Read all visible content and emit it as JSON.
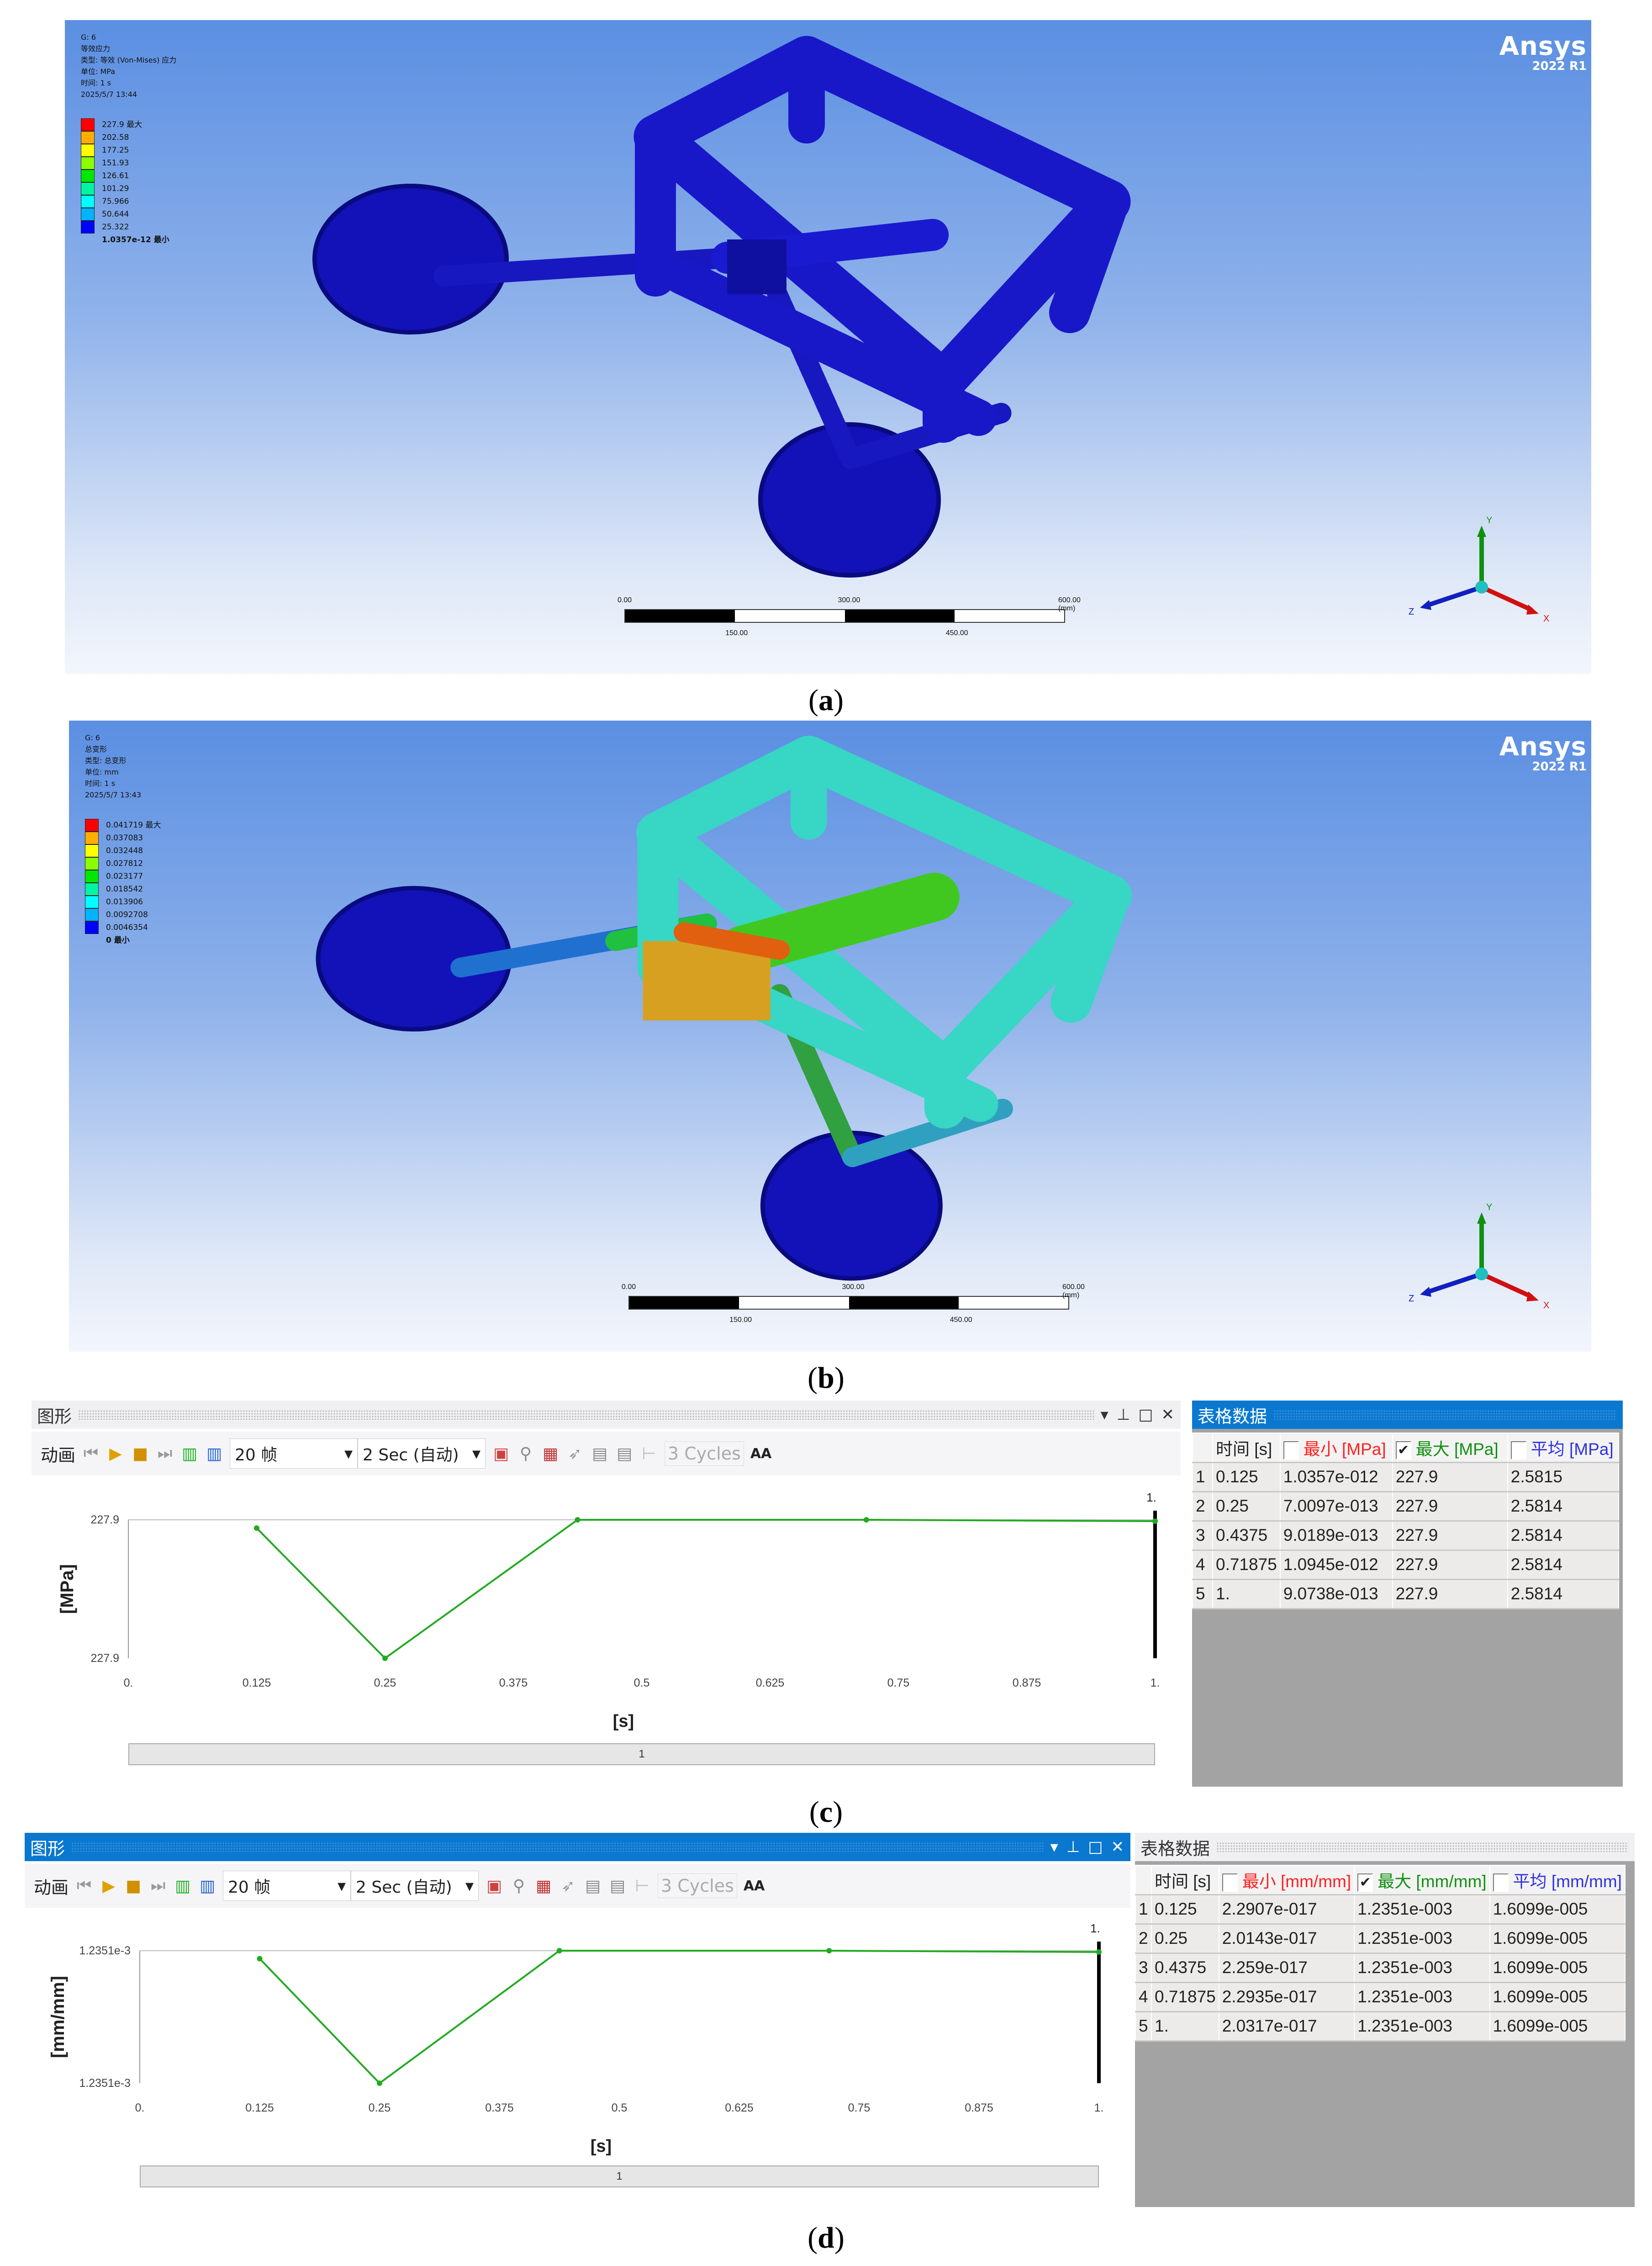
{
  "panel_a": {
    "caption": "a",
    "legend_header": [
      "G: 6",
      "等效应力",
      "类型: 等效 (Von-Mises) 应力",
      "单位: MPa",
      "时间: 1 s",
      "2025/5/7 13:44"
    ],
    "legend_values": [
      "227.9 最大",
      "202.58",
      "177.25",
      "151.93",
      "126.61",
      "101.29",
      "75.966",
      "50.644",
      "25.322",
      "1.0357e-12 最小"
    ],
    "logo": "Ansys",
    "version": "2022 R1",
    "scale_top": [
      "0.00",
      "300.00",
      "600.00 (mm)"
    ],
    "scale_bottom": [
      "150.00",
      "450.00"
    ],
    "axes": [
      "Y",
      "Z",
      "X"
    ]
  },
  "panel_b": {
    "caption": "b",
    "legend_header": [
      "G: 6",
      "总变形",
      "类型: 总变形",
      "单位: mm",
      "时间: 1 s",
      "2025/5/7 13:43"
    ],
    "legend_values": [
      "0.041719 最大",
      "0.037083",
      "0.032448",
      "0.027812",
      "0.023177",
      "0.018542",
      "0.013906",
      "0.0092708",
      "0.0046354",
      "0 最小"
    ],
    "logo": "Ansys",
    "version": "2022 R1",
    "scale_top": [
      "0.00",
      "300.00",
      "600.00 (mm)"
    ],
    "scale_bottom": [
      "150.00",
      "450.00"
    ],
    "axes": [
      "Y",
      "Z",
      "X"
    ]
  },
  "legend_colors": [
    "#ff0000",
    "#ffad00",
    "#ffff00",
    "#8cff00",
    "#00e800",
    "#00f5a0",
    "#00ffff",
    "#00b4ff",
    "#0000ff"
  ],
  "toolbar": {
    "animation": "动画",
    "frames": "20 帧",
    "duration": "2 Sec (自动)",
    "cycles": "3 Cycles",
    "aa": "AA"
  },
  "panel_c": {
    "caption": "c",
    "graph_title": "图形",
    "table_title": "表格数据",
    "table_headers": [
      "时间 [s]",
      "最小 [MPa]",
      "最大 [MPa]",
      "平均 [MPa]"
    ],
    "header_checked": [
      false,
      true,
      false
    ],
    "rows": [
      [
        "1",
        "0.125",
        "1.0357e-012",
        "227.9",
        "2.5815"
      ],
      [
        "2",
        "0.25",
        "7.0097e-013",
        "227.9",
        "2.5814"
      ],
      [
        "3",
        "0.4375",
        "9.0189e-013",
        "227.9",
        "2.5814"
      ],
      [
        "4",
        "0.71875",
        "1.0945e-012",
        "227.9",
        "2.5814"
      ],
      [
        "5",
        "1.",
        "9.0738e-013",
        "227.9",
        "2.5814"
      ]
    ],
    "scroll_label": "1"
  },
  "panel_d": {
    "caption": "d",
    "graph_title": "图形",
    "table_title": "表格数据",
    "table_headers": [
      "时间 [s]",
      "最小 [mm/mm]",
      "最大 [mm/mm]",
      "平均 [mm/mm]"
    ],
    "header_checked": [
      false,
      true,
      false
    ],
    "rows": [
      [
        "1",
        "0.125",
        "2.2907e-017",
        "1.2351e-003",
        "1.6099e-005"
      ],
      [
        "2",
        "0.25",
        "2.0143e-017",
        "1.2351e-003",
        "1.6099e-005"
      ],
      [
        "3",
        "0.4375",
        "2.259e-017",
        "1.2351e-003",
        "1.6099e-005"
      ],
      [
        "4",
        "0.71875",
        "2.2935e-017",
        "1.2351e-003",
        "1.6099e-005"
      ],
      [
        "5",
        "1.",
        "2.0317e-017",
        "1.2351e-003",
        "1.6099e-005"
      ]
    ],
    "scroll_label": "1"
  },
  "header_colors": [
    "#222222",
    "#ff2020",
    "#109010",
    "#3030e0"
  ],
  "chart_data": [
    {
      "type": "line",
      "ylabel": "[MPa]",
      "xlabel": "[s]",
      "x_ticks": [
        "0.",
        "0.125",
        "0.25",
        "0.375",
        "0.5",
        "0.625",
        "0.75",
        "0.875",
        "1."
      ],
      "xlim": [
        0,
        1
      ],
      "y_tick_labels": [
        "227.9",
        "227.9"
      ],
      "cursor_label": "1.",
      "series": [
        {
          "name": "最大 [MPa]",
          "color": "#22aa22",
          "x": [
            0.125,
            0.25,
            0.4375,
            0.71875,
            1.0
          ],
          "relative_y": [
            0.94,
            0.0,
            1.0,
            1.0,
            0.99
          ]
        }
      ]
    },
    {
      "type": "line",
      "ylabel": "[mm/mm]",
      "xlabel": "[s]",
      "x_ticks": [
        "0.",
        "0.125",
        "0.25",
        "0.375",
        "0.5",
        "0.625",
        "0.75",
        "0.875",
        "1."
      ],
      "xlim": [
        0,
        1
      ],
      "y_tick_labels": [
        "1.2351e-3",
        "1.2351e-3"
      ],
      "cursor_label": "1.",
      "series": [
        {
          "name": "最大 [mm/mm]",
          "color": "#22aa22",
          "x": [
            0.125,
            0.25,
            0.4375,
            0.71875,
            1.0
          ],
          "relative_y": [
            0.94,
            0.0,
            1.0,
            1.0,
            0.99
          ]
        }
      ]
    }
  ]
}
